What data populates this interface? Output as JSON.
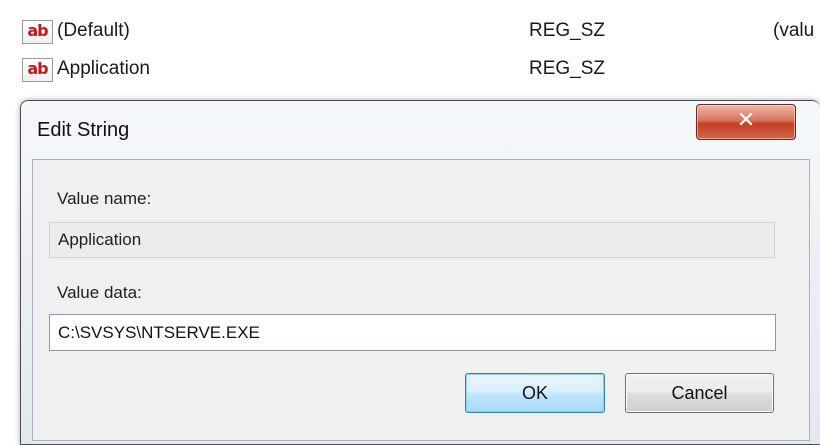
{
  "registry": {
    "rows": [
      {
        "icon": "ab",
        "name": "(Default)",
        "type": "REG_SZ",
        "data": "(valu"
      },
      {
        "icon": "ab",
        "name": "Application",
        "type": "REG_SZ",
        "data": ""
      }
    ]
  },
  "dialog": {
    "title": "Edit String",
    "close_label": "✕",
    "value_name_label": "Value name:",
    "value_name": "Application",
    "value_data_label": "Value data:",
    "value_data": "C:\\SVSYS\\NTSERVE.EXE",
    "ok_label": "OK",
    "cancel_label": "Cancel"
  },
  "colors": {
    "string_icon": "#c41818",
    "close_button": "#c43f24",
    "ok_button_border": "#3c7fb1"
  }
}
